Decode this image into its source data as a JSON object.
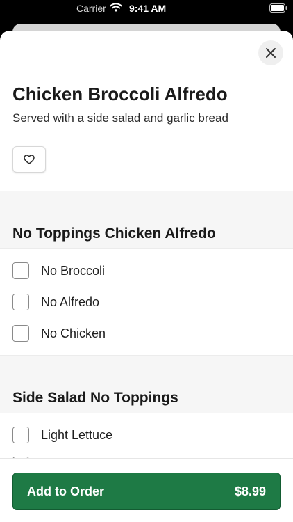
{
  "status_bar": {
    "carrier": "Carrier",
    "time": "9:41 AM"
  },
  "item": {
    "title": "Chicken Broccoli Alfredo",
    "description": "Served with a side salad and garlic bread"
  },
  "icons": {
    "close": "close-icon",
    "favorite": "heart-icon",
    "wifi": "wifi-icon",
    "battery": "battery-icon"
  },
  "sections": [
    {
      "title": "No Toppings Chicken Alfredo",
      "options": [
        {
          "label": "No Broccoli",
          "checked": false
        },
        {
          "label": "No Alfredo",
          "checked": false
        },
        {
          "label": "No Chicken",
          "checked": false
        }
      ]
    },
    {
      "title": "Side Salad No Toppings",
      "options": [
        {
          "label": "Light Lettuce",
          "checked": false
        }
      ]
    }
  ],
  "footer": {
    "button_label": "Add to Order",
    "price": "$8.99"
  },
  "colors": {
    "accent": "#1e7a45",
    "section_background": "#f6f6f6"
  }
}
